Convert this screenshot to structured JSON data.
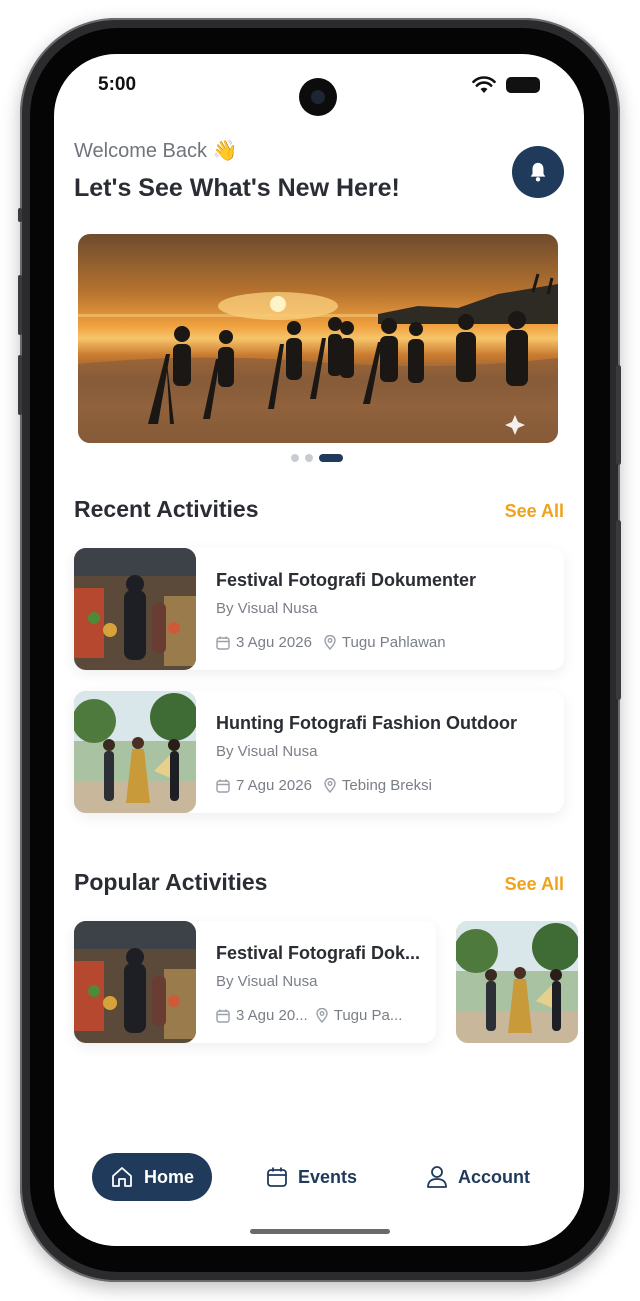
{
  "status": {
    "time": "5:00"
  },
  "header": {
    "welcome": "Welcome Back 👋",
    "headline": "Let's See What's New Here!"
  },
  "carousel": {
    "slides": 3,
    "active_index": 2
  },
  "recent": {
    "title": "Recent Activities",
    "see_all": "See All",
    "items": [
      {
        "title": "Festival Fotografi Dokumenter",
        "by": "By Visual Nusa",
        "date": "3 Agu 2026",
        "location": "Tugu Pahlawan"
      },
      {
        "title": "Hunting Fotografi Fashion Outdoor",
        "by": "By Visual Nusa",
        "date": "7 Agu 2026",
        "location": "Tebing Breksi"
      }
    ]
  },
  "popular": {
    "title": "Popular Activities",
    "see_all": "See All",
    "items": [
      {
        "title": "Festival Fotografi Dok...",
        "by": "By Visual Nusa",
        "date": "3 Agu 20...",
        "location": "Tugu Pa..."
      }
    ]
  },
  "nav": {
    "home": "Home",
    "events": "Events",
    "account": "Account"
  },
  "colors": {
    "primary": "#1f3a5a",
    "accent": "#f0a21c",
    "text": "#2a2d33",
    "muted": "#7a7f87"
  }
}
